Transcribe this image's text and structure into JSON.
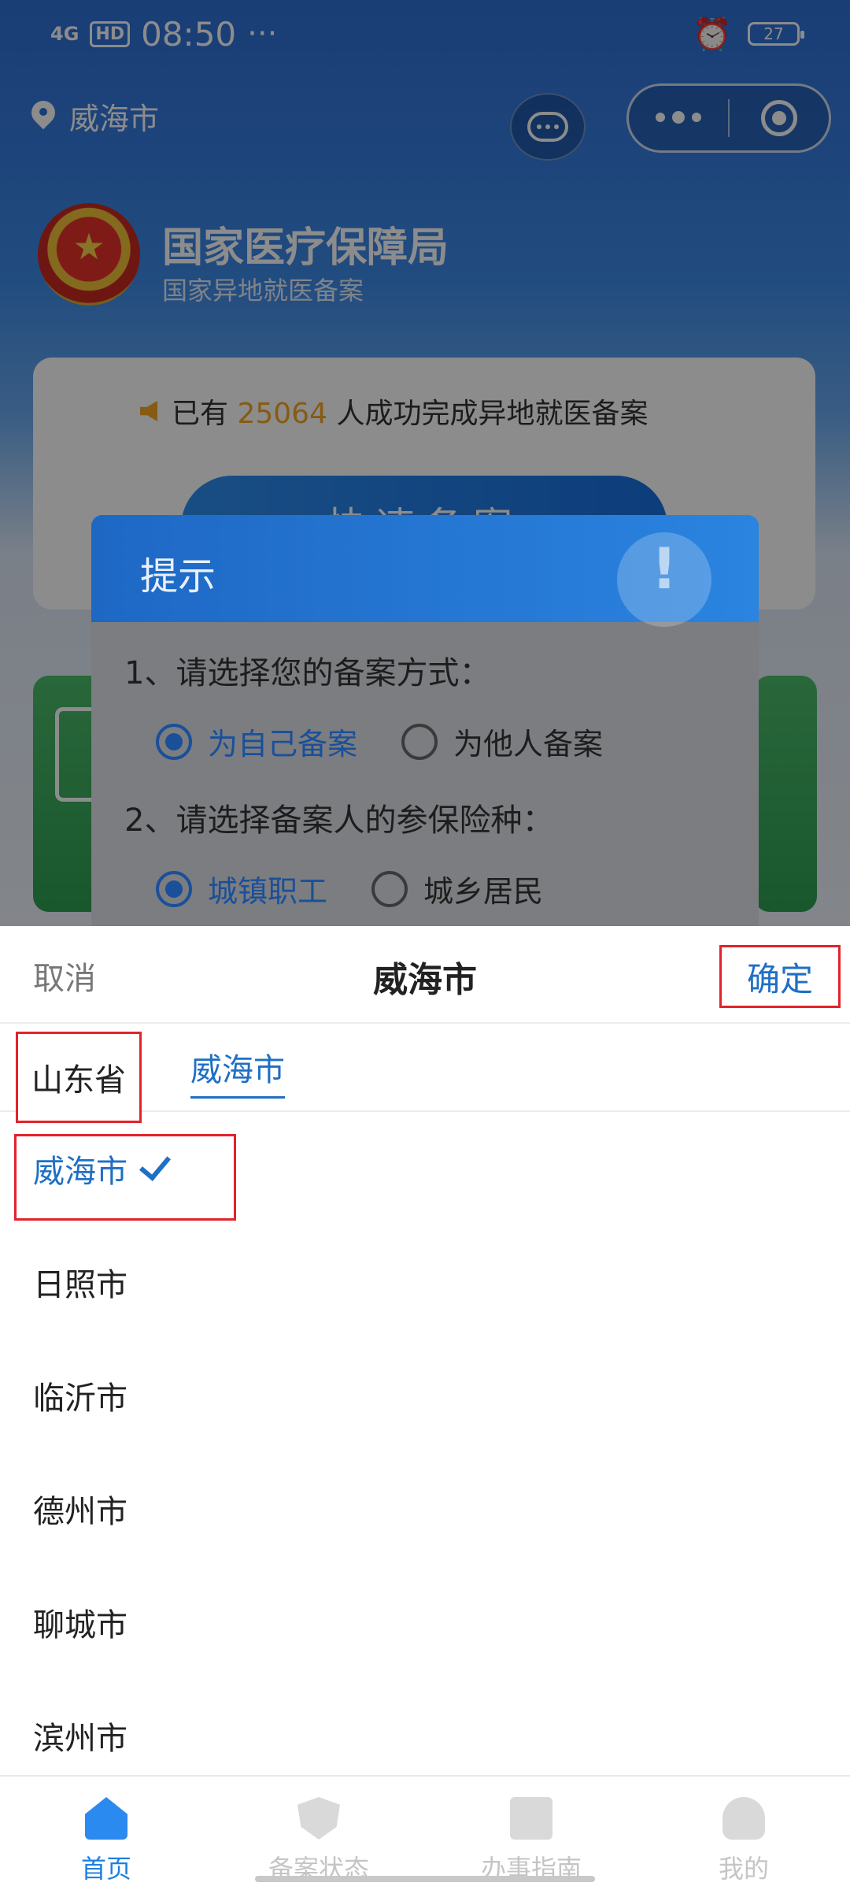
{
  "status_bar": {
    "signal": "4G",
    "hd": "HD",
    "time": "08:50",
    "extra": "···",
    "battery": "27"
  },
  "header": {
    "location": "威海市"
  },
  "org": {
    "title": "国家医疗保障局",
    "subtitle": "国家异地就医备案"
  },
  "notice": {
    "prefix": "已有",
    "count": "25064",
    "suffix": "人成功完成异地就医备案"
  },
  "fast_button": {
    "label": "快速备案"
  },
  "modal": {
    "title": "提示",
    "q1": "1、请选择您的备案方式：",
    "q1_options": [
      "为自己备案",
      "为他人备案"
    ],
    "q2": "2、请选择备案人的参保险种：",
    "q2_options": [
      "城镇职工",
      "城乡居民"
    ]
  },
  "picker": {
    "cancel": "取消",
    "title": "威海市",
    "confirm": "确定",
    "tab_province": "山东省",
    "tab_city": "威海市",
    "cities": [
      "威海市",
      "日照市",
      "临沂市",
      "德州市",
      "聊城市",
      "滨州市"
    ]
  },
  "tabbar": {
    "items": [
      "首页",
      "备案状态",
      "办事指南",
      "我的"
    ]
  },
  "colors": {
    "accent": "#1f6fc5",
    "highlight_box": "#e2232a",
    "notice_count": "#f5a623"
  }
}
